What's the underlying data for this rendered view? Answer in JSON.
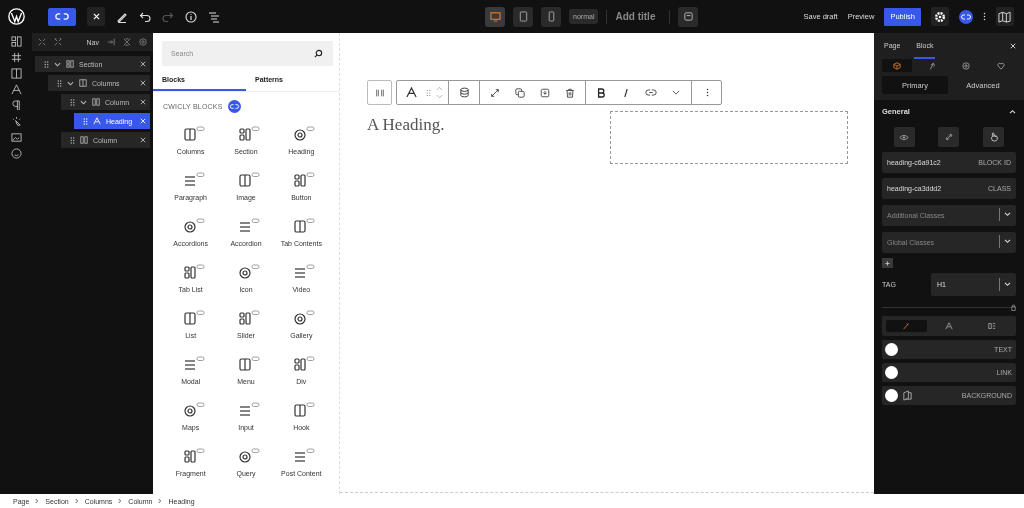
{
  "topbar": {
    "devices": [
      {
        "kind": "desktop",
        "selected": true
      },
      {
        "kind": "tablet",
        "selected": false
      },
      {
        "kind": "mobile",
        "selected": false
      }
    ],
    "state": "normal",
    "title_placeholder": "Add title",
    "redo_disabled": true,
    "save_draft": "Save draft",
    "preview": "Preview",
    "publish": "Publish"
  },
  "navigator": {
    "title": "Nav",
    "tree": [
      {
        "label": "Section",
        "kind": "section",
        "selected": false,
        "expanded": true,
        "children": [
          {
            "label": "Columns",
            "kind": "columns",
            "selected": false,
            "expanded": true,
            "children": [
              {
                "label": "Column",
                "kind": "column",
                "selected": false,
                "expanded": true,
                "children": [
                  {
                    "label": "Heading",
                    "kind": "heading",
                    "selected": true
                  }
                ]
              },
              {
                "label": "Column",
                "kind": "column",
                "selected": false
              }
            ]
          }
        ]
      }
    ]
  },
  "inserter": {
    "search_placeholder": "Search",
    "tabs": [
      {
        "label": "Blocks",
        "selected": true
      },
      {
        "label": "Patterns",
        "selected": false
      }
    ],
    "group": "CWICLY BLOCKS",
    "blocks": [
      "Columns",
      "Section",
      "Heading",
      "Paragraph",
      "Image",
      "Button",
      "Accordions",
      "Accordion",
      "Tab Contents",
      "Tab List",
      "Icon",
      "Video",
      "List",
      "Slider",
      "Gallery",
      "Modal",
      "Menu",
      "Div",
      "Maps",
      "Input",
      "Hook",
      "Fragment",
      "Query",
      "Post Content"
    ]
  },
  "canvas": {
    "heading": "A Heading."
  },
  "inspector": {
    "tabs": [
      {
        "label": "Page",
        "selected": false
      },
      {
        "label": "Block",
        "selected": true
      }
    ],
    "icon_tabs": [
      {
        "selected": true
      },
      {
        "selected": false
      },
      {
        "selected": false
      },
      {
        "selected": false
      }
    ],
    "modes": [
      {
        "label": "Primary",
        "selected": true
      },
      {
        "label": "Advanced",
        "selected": false
      }
    ],
    "section": "General",
    "section_expanded": true,
    "fields": [
      {
        "value": "heading-c6a91c2",
        "tag": "BLOCK ID"
      },
      {
        "value": "heading-ca3ddd2",
        "tag": "CLASS"
      }
    ],
    "selects": [
      {
        "placeholder": "Additional Classes"
      },
      {
        "placeholder": "Global Classes"
      }
    ],
    "tag_label": "TAG",
    "tag_value": "H1",
    "style_tabs": [
      {
        "selected": true
      },
      {
        "selected": false
      },
      {
        "selected": false
      }
    ],
    "colors": [
      {
        "label": "TEXT",
        "color": "#ffffff"
      },
      {
        "label": "LINK",
        "color": "#ffffff"
      },
      {
        "label": "BACKGROUND",
        "color": "#ffffff"
      }
    ]
  },
  "breadcrumb": [
    "Page",
    "Section",
    "Columns",
    "Column",
    "Heading"
  ]
}
